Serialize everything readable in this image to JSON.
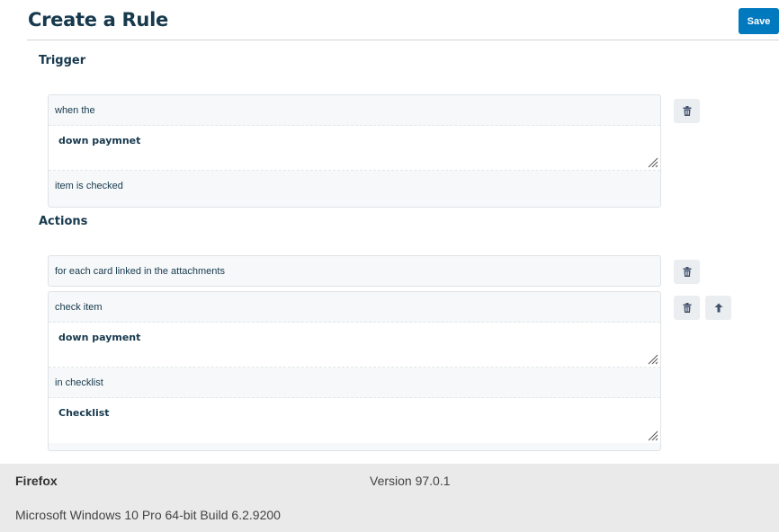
{
  "header": {
    "title": "Create a Rule",
    "save_label": "Save"
  },
  "trigger": {
    "section_title": "Trigger",
    "prefix": "when the",
    "item_name": "down paymnet",
    "suffix": "item is checked"
  },
  "actions": {
    "section_title": "Actions",
    "scope_text": "for each card linked in the attachments",
    "action_prefix": "check item",
    "item_name": "down payment",
    "checklist_prefix": "in checklist",
    "checklist_name": "Checklist"
  },
  "icons": {
    "delete": "trash-icon",
    "move_up": "arrow-up-icon",
    "resize": "resize-grip-icon"
  },
  "footer": {
    "browser": "Firefox",
    "version": "Version 97.0.1",
    "os": "Microsoft Windows 10 Pro 64-bit Build 6.2.9200"
  },
  "colors": {
    "primary": "#0079bf",
    "text": "#17394d",
    "card_bg": "#f6f8f9",
    "footer_bg": "#eaeaea"
  }
}
